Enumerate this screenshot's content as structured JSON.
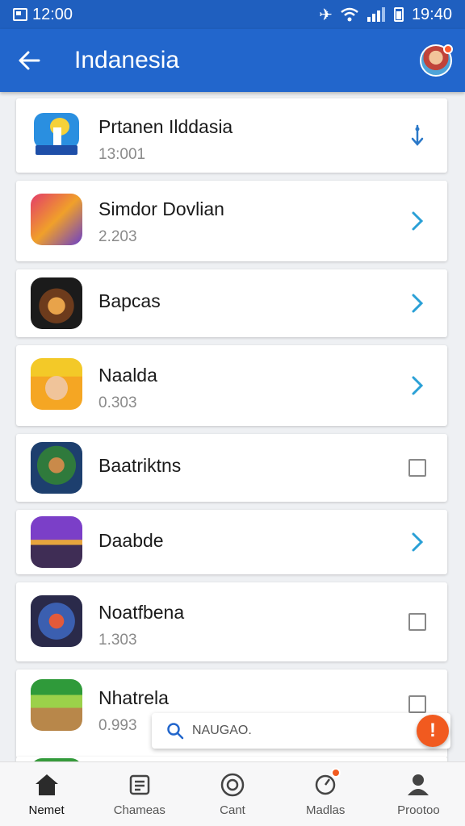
{
  "status_bar": {
    "left_time": "12:00",
    "right_time": "19:40"
  },
  "app_bar": {
    "title": "Indanesia"
  },
  "list": [
    {
      "title": "Prtanen Ilddasia",
      "subtitle": "13:001",
      "action": "download-icon"
    },
    {
      "title": "Simdor Dovlian",
      "subtitle": "2.203",
      "action": "chevron-right-icon"
    },
    {
      "title": "Bapcas",
      "subtitle": "",
      "action": "chevron-right-icon"
    },
    {
      "title": "Naalda",
      "subtitle": "0.303",
      "action": "chevron-right-icon"
    },
    {
      "title": "Baatriktns",
      "subtitle": "",
      "action": "checkbox"
    },
    {
      "title": "Daabde",
      "subtitle": "",
      "action": "chevron-right-icon"
    },
    {
      "title": "Noatfbena",
      "subtitle": "1.303",
      "action": "checkbox"
    },
    {
      "title": "Nhatrela",
      "subtitle": "0.993",
      "action": "checkbox"
    }
  ],
  "search": {
    "placeholder": "NAUGAO."
  },
  "fab": {
    "label": "!"
  },
  "bottom_nav": [
    {
      "label": "Nemet",
      "icon": "home-icon",
      "active": true
    },
    {
      "label": "Chameas",
      "icon": "news-icon",
      "active": false
    },
    {
      "label": "Cant",
      "icon": "circle-icon",
      "active": false
    },
    {
      "label": "Madlas",
      "icon": "location-icon",
      "active": false
    },
    {
      "label": "Prootoo",
      "icon": "person-icon",
      "active": false
    }
  ],
  "colors": {
    "primary": "#2266cc",
    "status": "#1f5fbf",
    "accent": "#f15a1f",
    "chevron": "#2aa0d6"
  }
}
